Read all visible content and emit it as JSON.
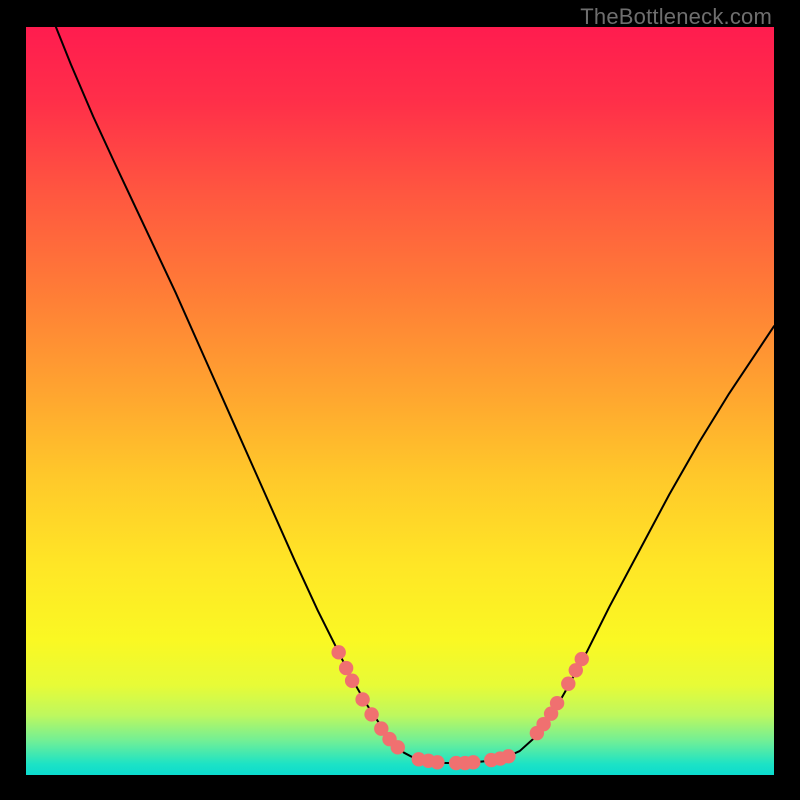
{
  "watermark": "TheBottleneck.com",
  "colors": {
    "background": "#000000",
    "gradient_stops": [
      {
        "offset": 0.0,
        "color": "#ff1c4f"
      },
      {
        "offset": 0.1,
        "color": "#ff2f49"
      },
      {
        "offset": 0.22,
        "color": "#ff5640"
      },
      {
        "offset": 0.35,
        "color": "#ff7b37"
      },
      {
        "offset": 0.48,
        "color": "#ffa230"
      },
      {
        "offset": 0.6,
        "color": "#ffc82a"
      },
      {
        "offset": 0.72,
        "color": "#ffe626"
      },
      {
        "offset": 0.82,
        "color": "#faf823"
      },
      {
        "offset": 0.88,
        "color": "#e7fb37"
      },
      {
        "offset": 0.92,
        "color": "#bef85e"
      },
      {
        "offset": 0.955,
        "color": "#6fef97"
      },
      {
        "offset": 0.985,
        "color": "#1de3c5"
      },
      {
        "offset": 1.0,
        "color": "#0bdbcf"
      }
    ],
    "curve": "#000000",
    "dot_fill": "#f07070",
    "dot_stroke": "#e85a5a"
  },
  "chart_data": {
    "type": "line",
    "title": "",
    "xlabel": "",
    "ylabel": "",
    "xlim": [
      0,
      100
    ],
    "ylim": [
      0,
      100
    ],
    "curve": [
      {
        "x": 4.0,
        "y": 100.0
      },
      {
        "x": 6.0,
        "y": 95.0
      },
      {
        "x": 9.0,
        "y": 88.0
      },
      {
        "x": 12.0,
        "y": 81.5
      },
      {
        "x": 16.0,
        "y": 73.0
      },
      {
        "x": 20.0,
        "y": 64.5
      },
      {
        "x": 24.0,
        "y": 55.5
      },
      {
        "x": 28.0,
        "y": 46.5
      },
      {
        "x": 32.0,
        "y": 37.5
      },
      {
        "x": 36.0,
        "y": 28.5
      },
      {
        "x": 39.0,
        "y": 22.0
      },
      {
        "x": 41.5,
        "y": 17.0
      },
      {
        "x": 43.5,
        "y": 13.0
      },
      {
        "x": 45.5,
        "y": 9.5
      },
      {
        "x": 47.5,
        "y": 6.5
      },
      {
        "x": 49.0,
        "y": 4.5
      },
      {
        "x": 50.5,
        "y": 3.0
      },
      {
        "x": 52.0,
        "y": 2.2
      },
      {
        "x": 54.0,
        "y": 1.8
      },
      {
        "x": 56.0,
        "y": 1.6
      },
      {
        "x": 58.0,
        "y": 1.6
      },
      {
        "x": 60.0,
        "y": 1.7
      },
      {
        "x": 62.0,
        "y": 1.9
      },
      {
        "x": 64.0,
        "y": 2.3
      },
      {
        "x": 66.0,
        "y": 3.2
      },
      {
        "x": 68.0,
        "y": 5.0
      },
      {
        "x": 70.0,
        "y": 7.5
      },
      {
        "x": 72.0,
        "y": 11.0
      },
      {
        "x": 75.0,
        "y": 16.5
      },
      {
        "x": 78.0,
        "y": 22.5
      },
      {
        "x": 82.0,
        "y": 30.0
      },
      {
        "x": 86.0,
        "y": 37.5
      },
      {
        "x": 90.0,
        "y": 44.5
      },
      {
        "x": 94.0,
        "y": 51.0
      },
      {
        "x": 98.0,
        "y": 57.0
      },
      {
        "x": 100.0,
        "y": 60.0
      }
    ],
    "dots": [
      {
        "x": 41.8,
        "y": 16.4
      },
      {
        "x": 42.8,
        "y": 14.3
      },
      {
        "x": 43.6,
        "y": 12.6
      },
      {
        "x": 45.0,
        "y": 10.1
      },
      {
        "x": 46.2,
        "y": 8.1
      },
      {
        "x": 47.5,
        "y": 6.2
      },
      {
        "x": 48.6,
        "y": 4.8
      },
      {
        "x": 49.7,
        "y": 3.7
      },
      {
        "x": 52.5,
        "y": 2.1
      },
      {
        "x": 53.8,
        "y": 1.9
      },
      {
        "x": 55.0,
        "y": 1.7
      },
      {
        "x": 57.5,
        "y": 1.6
      },
      {
        "x": 58.7,
        "y": 1.6
      },
      {
        "x": 59.8,
        "y": 1.7
      },
      {
        "x": 62.2,
        "y": 2.0
      },
      {
        "x": 63.4,
        "y": 2.2
      },
      {
        "x": 64.5,
        "y": 2.5
      },
      {
        "x": 68.3,
        "y": 5.6
      },
      {
        "x": 69.2,
        "y": 6.8
      },
      {
        "x": 70.2,
        "y": 8.2
      },
      {
        "x": 71.0,
        "y": 9.6
      },
      {
        "x": 72.5,
        "y": 12.2
      },
      {
        "x": 73.5,
        "y": 14.0
      },
      {
        "x": 74.3,
        "y": 15.5
      }
    ]
  }
}
